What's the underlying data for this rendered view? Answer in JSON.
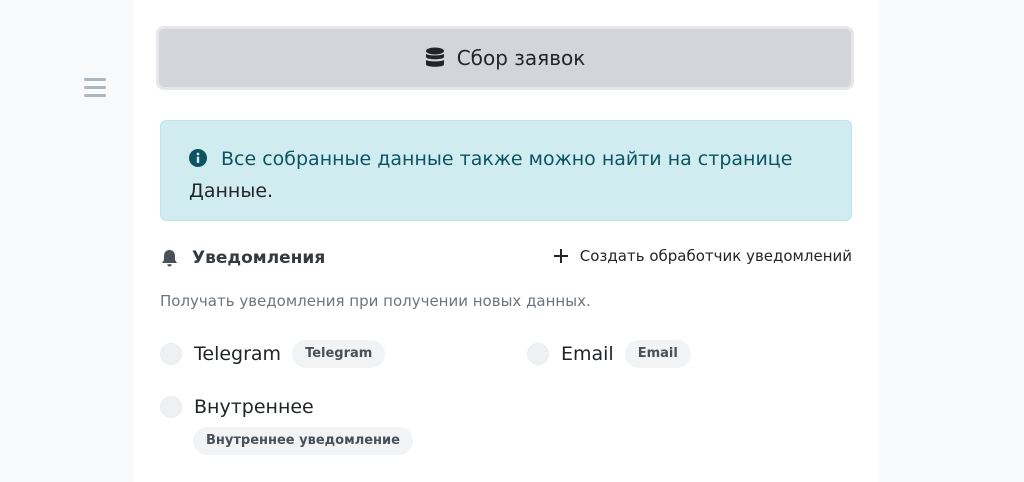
{
  "header": {
    "button_label": "Сбор заявок",
    "button_icon": "database-icon"
  },
  "alert": {
    "text": "Все собранные данные также можно найти на странице",
    "link_text": "Данные.",
    "icon": "info-circle-icon",
    "colors": {
      "background": "#d1ecf1",
      "text": "#0c5460"
    }
  },
  "notifications": {
    "title": "Уведомления",
    "title_icon": "bell-icon",
    "create_label": "Создать обработчик уведомлений",
    "create_icon": "plus-icon",
    "description": "Получать уведомления при получении новых данных.",
    "options": [
      {
        "label": "Telegram",
        "badge": "Telegram",
        "checked": false
      },
      {
        "label": "Email",
        "badge": "Email",
        "checked": false
      },
      {
        "label": "Внутреннее",
        "badge": "Внутреннее уведомление",
        "checked": false
      }
    ]
  },
  "sidebar": {
    "menu_icon": "hamburger-menu-icon"
  }
}
